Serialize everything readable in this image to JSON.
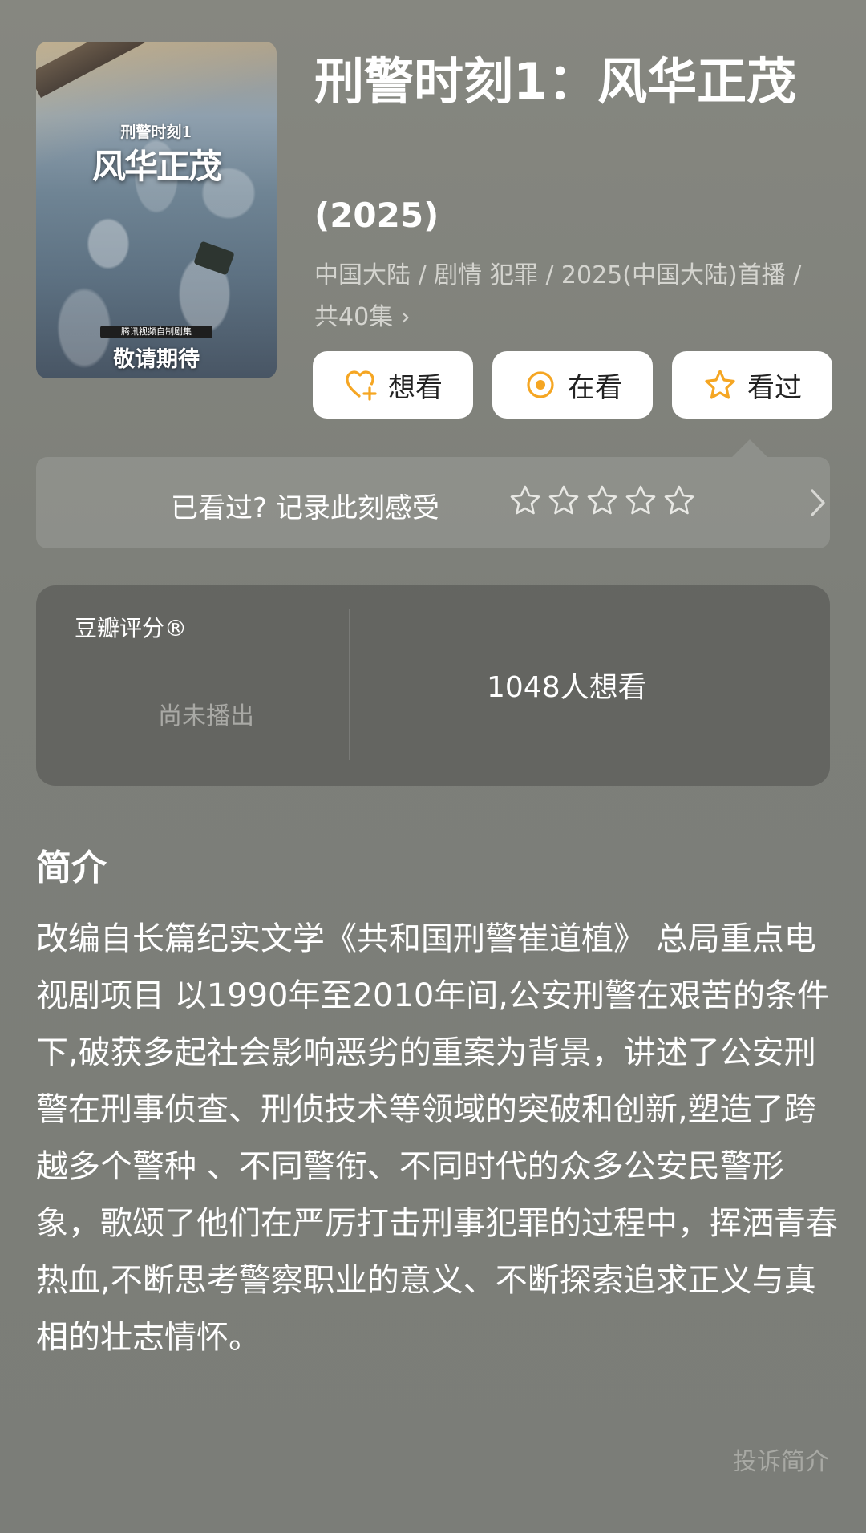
{
  "poster": {
    "subtitle": "刑警时刻1",
    "title": "风华正茂",
    "badge": "腾讯视频自制剧集",
    "slogan": "敬请期待"
  },
  "title": "刑警时刻1：风华正茂",
  "year": "(2025)",
  "meta": "中国大陆 / 剧情 犯罪 / 2025(中国大陆)首播 / 共40集 ›",
  "actions": {
    "want": "想看",
    "watching": "在看",
    "watched": "看过"
  },
  "rating_prompt": {
    "text": "已看过? 记录此刻感受",
    "stars": 0,
    "max_stars": 5
  },
  "score_card": {
    "label": "豆瓣评分®",
    "status": "尚未播出",
    "wish_count": "1048人想看"
  },
  "intro": {
    "heading": "简介",
    "text": "改编自长篇纪实文学《共和国刑警崔道植》 总局重点电视剧项目 以1990年至2010年间,公安刑警在艰苦的条件下,破获多起社会影响恶劣的重案为背景，讲述了公安刑警在刑事侦查、刑侦技术等领域的突破和创新,塑造了跨越多个警种 、不同警衔、不同时代的众多公安民警形象，歌颂了他们在严厉打击刑事犯罪的过程中，挥洒青春热血,不断思考警察职业的意义、不断探索追求正义与真相的壮志情怀。",
    "report": "投诉简介"
  },
  "colors": {
    "accent": "#f5a623",
    "background": "#7f817b",
    "card": "#5a5a58"
  }
}
